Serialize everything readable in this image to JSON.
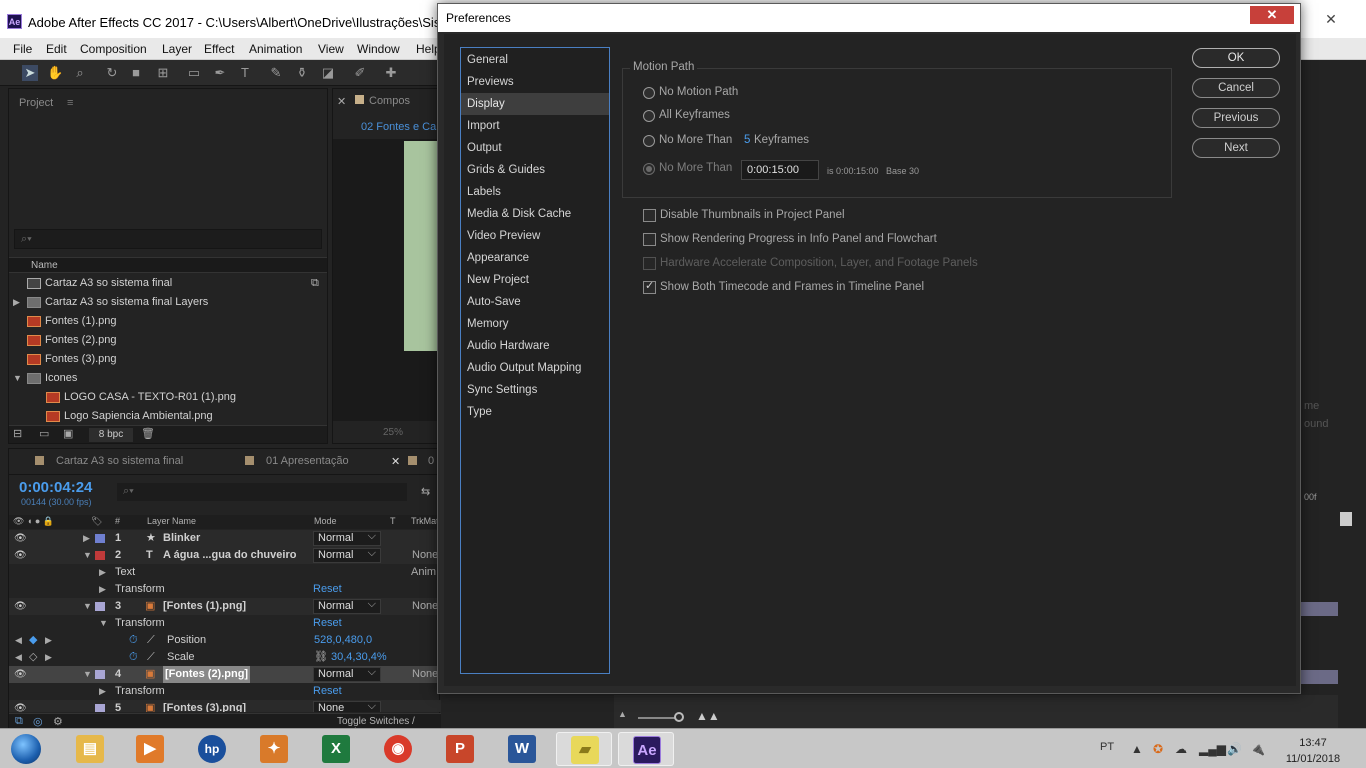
{
  "window": {
    "title": "Adobe After Effects CC 2017 - C:\\Users\\Albert\\OneDrive\\Ilustrações\\Sistema",
    "app_badge": "Ae"
  },
  "menu": [
    "File",
    "Edit",
    "Composition",
    "Layer",
    "Effect",
    "Animation",
    "View",
    "Window",
    "Help"
  ],
  "project": {
    "header": "Project",
    "search_placeholder": "⌕▾",
    "column_name": "Name",
    "items": [
      {
        "label": "Cartaz A3 so sistema final",
        "type": "comp"
      },
      {
        "label": "Cartaz A3 so sistema final Layers",
        "type": "folder"
      },
      {
        "label": "Fontes (1).png",
        "type": "png"
      },
      {
        "label": "Fontes (2).png",
        "type": "png"
      },
      {
        "label": "Fontes (3).png",
        "type": "png"
      },
      {
        "label": "Icones",
        "type": "folder"
      },
      {
        "label": "LOGO CASA - TEXTO-R01 (1).png",
        "type": "png"
      },
      {
        "label": "Logo Sapiencia Ambiental.png",
        "type": "png"
      }
    ],
    "bpc": "8 bpc"
  },
  "composition": {
    "tab": "Compos",
    "subtab": "02 Fontes e Ca",
    "zoom": "25%"
  },
  "timeline": {
    "tabs": [
      "Cartaz A3 so sistema final",
      "01 Apresentação",
      "0"
    ],
    "timecode": "0:00:04:24",
    "fps": "00144 (30.00 fps)",
    "search_placeholder": "⌕▾",
    "col_hash": "#",
    "col_layer_name": "Layer Name",
    "col_mode": "Mode",
    "col_t": "T",
    "col_trkmat": "TrkMat",
    "rows": [
      {
        "kind": "layer",
        "num": "1",
        "name": "Blinker",
        "mode": "Normal",
        "trk": "",
        "label_color": "#6f7fd0",
        "icon": "★"
      },
      {
        "kind": "layer",
        "num": "2",
        "name": "A água ...gua do chuveiro",
        "mode": "Normal",
        "trk": "None",
        "label_color": "#c03a3a",
        "icon": "T"
      },
      {
        "kind": "prop",
        "name": "Text",
        "value": "Anim"
      },
      {
        "kind": "prop",
        "name": "Transform",
        "value": "Reset"
      },
      {
        "kind": "layer",
        "num": "3",
        "name": "[Fontes (1).png]",
        "mode": "Normal",
        "trk": "None",
        "label_color": "#a9a6d4",
        "icon": "▣"
      },
      {
        "kind": "prop",
        "name": "Transform",
        "value": "Reset"
      },
      {
        "kind": "subprop",
        "name": "Position",
        "value": "528,0,480,0"
      },
      {
        "kind": "subprop",
        "name": "Scale",
        "value": "30,4,30,4%"
      },
      {
        "kind": "layer",
        "num": "4",
        "name": "[Fontes (2).png]",
        "mode": "Normal",
        "trk": "None",
        "label_color": "#a9a6d4",
        "icon": "▣",
        "selected": true
      },
      {
        "kind": "prop",
        "name": "Transform",
        "value": "Reset"
      },
      {
        "kind": "layer",
        "num": "5",
        "name": "[Fontes (3).png]",
        "mode": "None",
        "trk": "",
        "label_color": "#a9a6d4",
        "icon": "▣"
      }
    ],
    "toggle": "Toggle Switches / Modes"
  },
  "preferences": {
    "title": "Preferences",
    "close": "✕",
    "nav": [
      "General",
      "Previews",
      "Display",
      "Import",
      "Output",
      "Grids & Guides",
      "Labels",
      "Media & Disk Cache",
      "Video Preview",
      "Appearance",
      "New Project",
      "Auto-Save",
      "Memory",
      "Audio Hardware",
      "Audio Output Mapping",
      "Sync Settings",
      "Type"
    ],
    "active_nav": "Display",
    "motion_path": {
      "group_title": "Motion Path",
      "no_motion_path": "No Motion Path",
      "all_keyframes": "All Keyframes",
      "no_more_than_1": "No More Than",
      "keyframes_count": "5",
      "keyframes_label": "Keyframes",
      "no_more_than_2": "No More Than",
      "timecode": "0:00:15:00",
      "timecode_info": "is 0:00:15:00",
      "base": "Base 30",
      "selected": "No More Than (time)"
    },
    "checkboxes": [
      {
        "label": "Disable Thumbnails in Project Panel",
        "checked": false,
        "enabled": true
      },
      {
        "label": "Show Rendering Progress in Info Panel and Flowchart",
        "checked": false,
        "enabled": true
      },
      {
        "label": "Hardware Accelerate Composition, Layer, and Footage Panels",
        "checked": false,
        "enabled": false
      },
      {
        "label": "Show Both Timecode and Frames in Timeline Panel",
        "checked": true,
        "enabled": true
      }
    ],
    "buttons": {
      "ok": "OK",
      "cancel": "Cancel",
      "previous": "Previous",
      "next": "Next"
    }
  },
  "right_panel": {
    "text1": "me",
    "text2": "ound",
    "timecode_tail": "00f"
  },
  "taskbar": {
    "apps": [
      {
        "name": "File Explorer",
        "glyph": "▤",
        "color": "#e6b84a"
      },
      {
        "name": "Media Player",
        "glyph": "▶",
        "color": "#e07a2a"
      },
      {
        "name": "HP",
        "glyph": "hp",
        "color": "#1a4f9c"
      },
      {
        "name": "Tools",
        "glyph": "✦",
        "color": "#d97a2a"
      },
      {
        "name": "Excel",
        "glyph": "X",
        "color": "#1f7a3e"
      },
      {
        "name": "Chrome",
        "glyph": "◉",
        "color": "#d93a2a"
      },
      {
        "name": "PowerPoint",
        "glyph": "P",
        "color": "#c8462a"
      },
      {
        "name": "Word",
        "glyph": "W",
        "color": "#2a5699"
      },
      {
        "name": "Sticky Notes",
        "glyph": "▰",
        "color": "#e8d85a"
      },
      {
        "name": "After Effects",
        "glyph": "Ae",
        "color": "#2a1a5e"
      }
    ],
    "lang": "PT",
    "time": "13:47",
    "date": "11/01/2018"
  }
}
